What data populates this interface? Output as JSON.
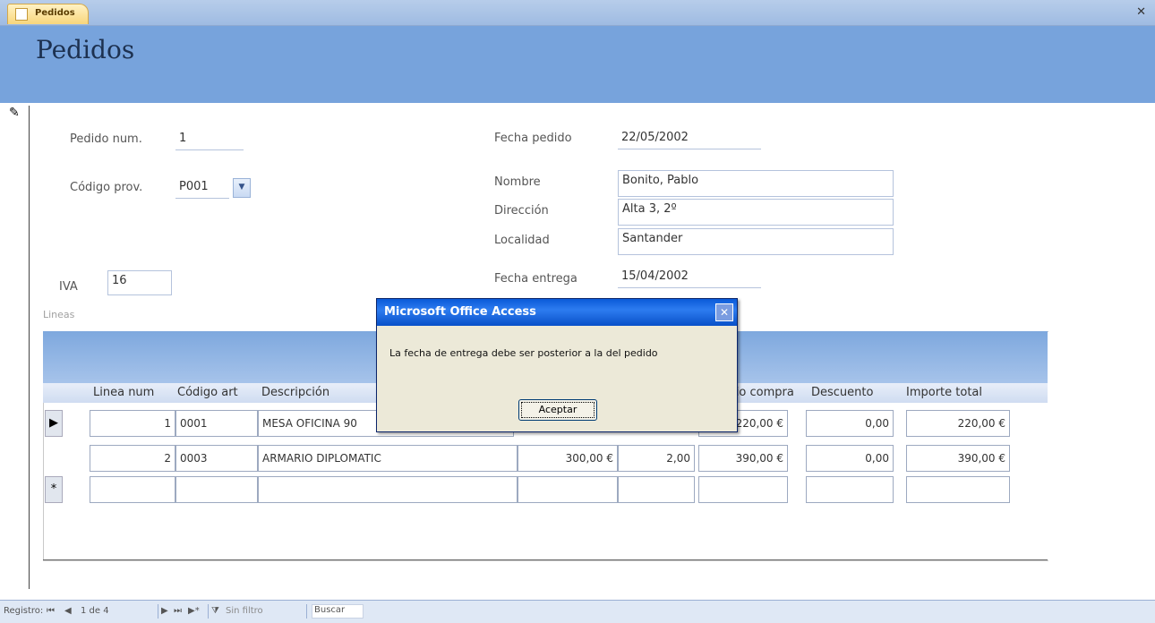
{
  "tab": {
    "label": "Pedidos"
  },
  "header": {
    "title": "Pedidos"
  },
  "form": {
    "pedido_num": {
      "label": "Pedido num.",
      "value": "1"
    },
    "codigo_prov": {
      "label": "Código prov.",
      "value": "P001"
    },
    "iva": {
      "label": "IVA",
      "value": "16"
    },
    "fecha_pedido": {
      "label": "Fecha pedido",
      "value": "22/05/2002"
    },
    "nombre": {
      "label": "Nombre",
      "value": "Bonito, Pablo"
    },
    "direccion": {
      "label": "Dirección",
      "value": "Alta 3, 2º"
    },
    "localidad": {
      "label": "Localidad",
      "value": "Santander"
    },
    "fecha_entrega": {
      "label": "Fecha entrega",
      "value": "15/04/2002"
    }
  },
  "subform": {
    "label": "Lineas",
    "columns": [
      "Linea num",
      "Código art",
      "Descripción",
      "Precio compra",
      "Descuento",
      "Importe total"
    ],
    "rows": [
      {
        "linea": "1",
        "codigo": "0001",
        "descripcion": "MESA OFICINA 90",
        "precio": "",
        "cantidad": "",
        "precio_compra": "220,00 €",
        "descuento": "0,00",
        "importe": "220,00 €"
      },
      {
        "linea": "2",
        "codigo": "0003",
        "descripcion": "ARMARIO DIPLOMATIC",
        "precio": "300,00 €",
        "cantidad": "2,00",
        "precio_compra": "390,00 €",
        "descuento": "0,00",
        "importe": "390,00 €"
      }
    ],
    "selector_current": "▶",
    "selector_new": "*"
  },
  "navbar": {
    "registro": "Registro:",
    "position": "1 de 4",
    "filter": "Sin filtro",
    "search": "Buscar"
  },
  "dialog": {
    "title": "Microsoft Office Access",
    "message": "La fecha de entrega debe ser posterior a la del pedido",
    "ok": "Aceptar"
  }
}
